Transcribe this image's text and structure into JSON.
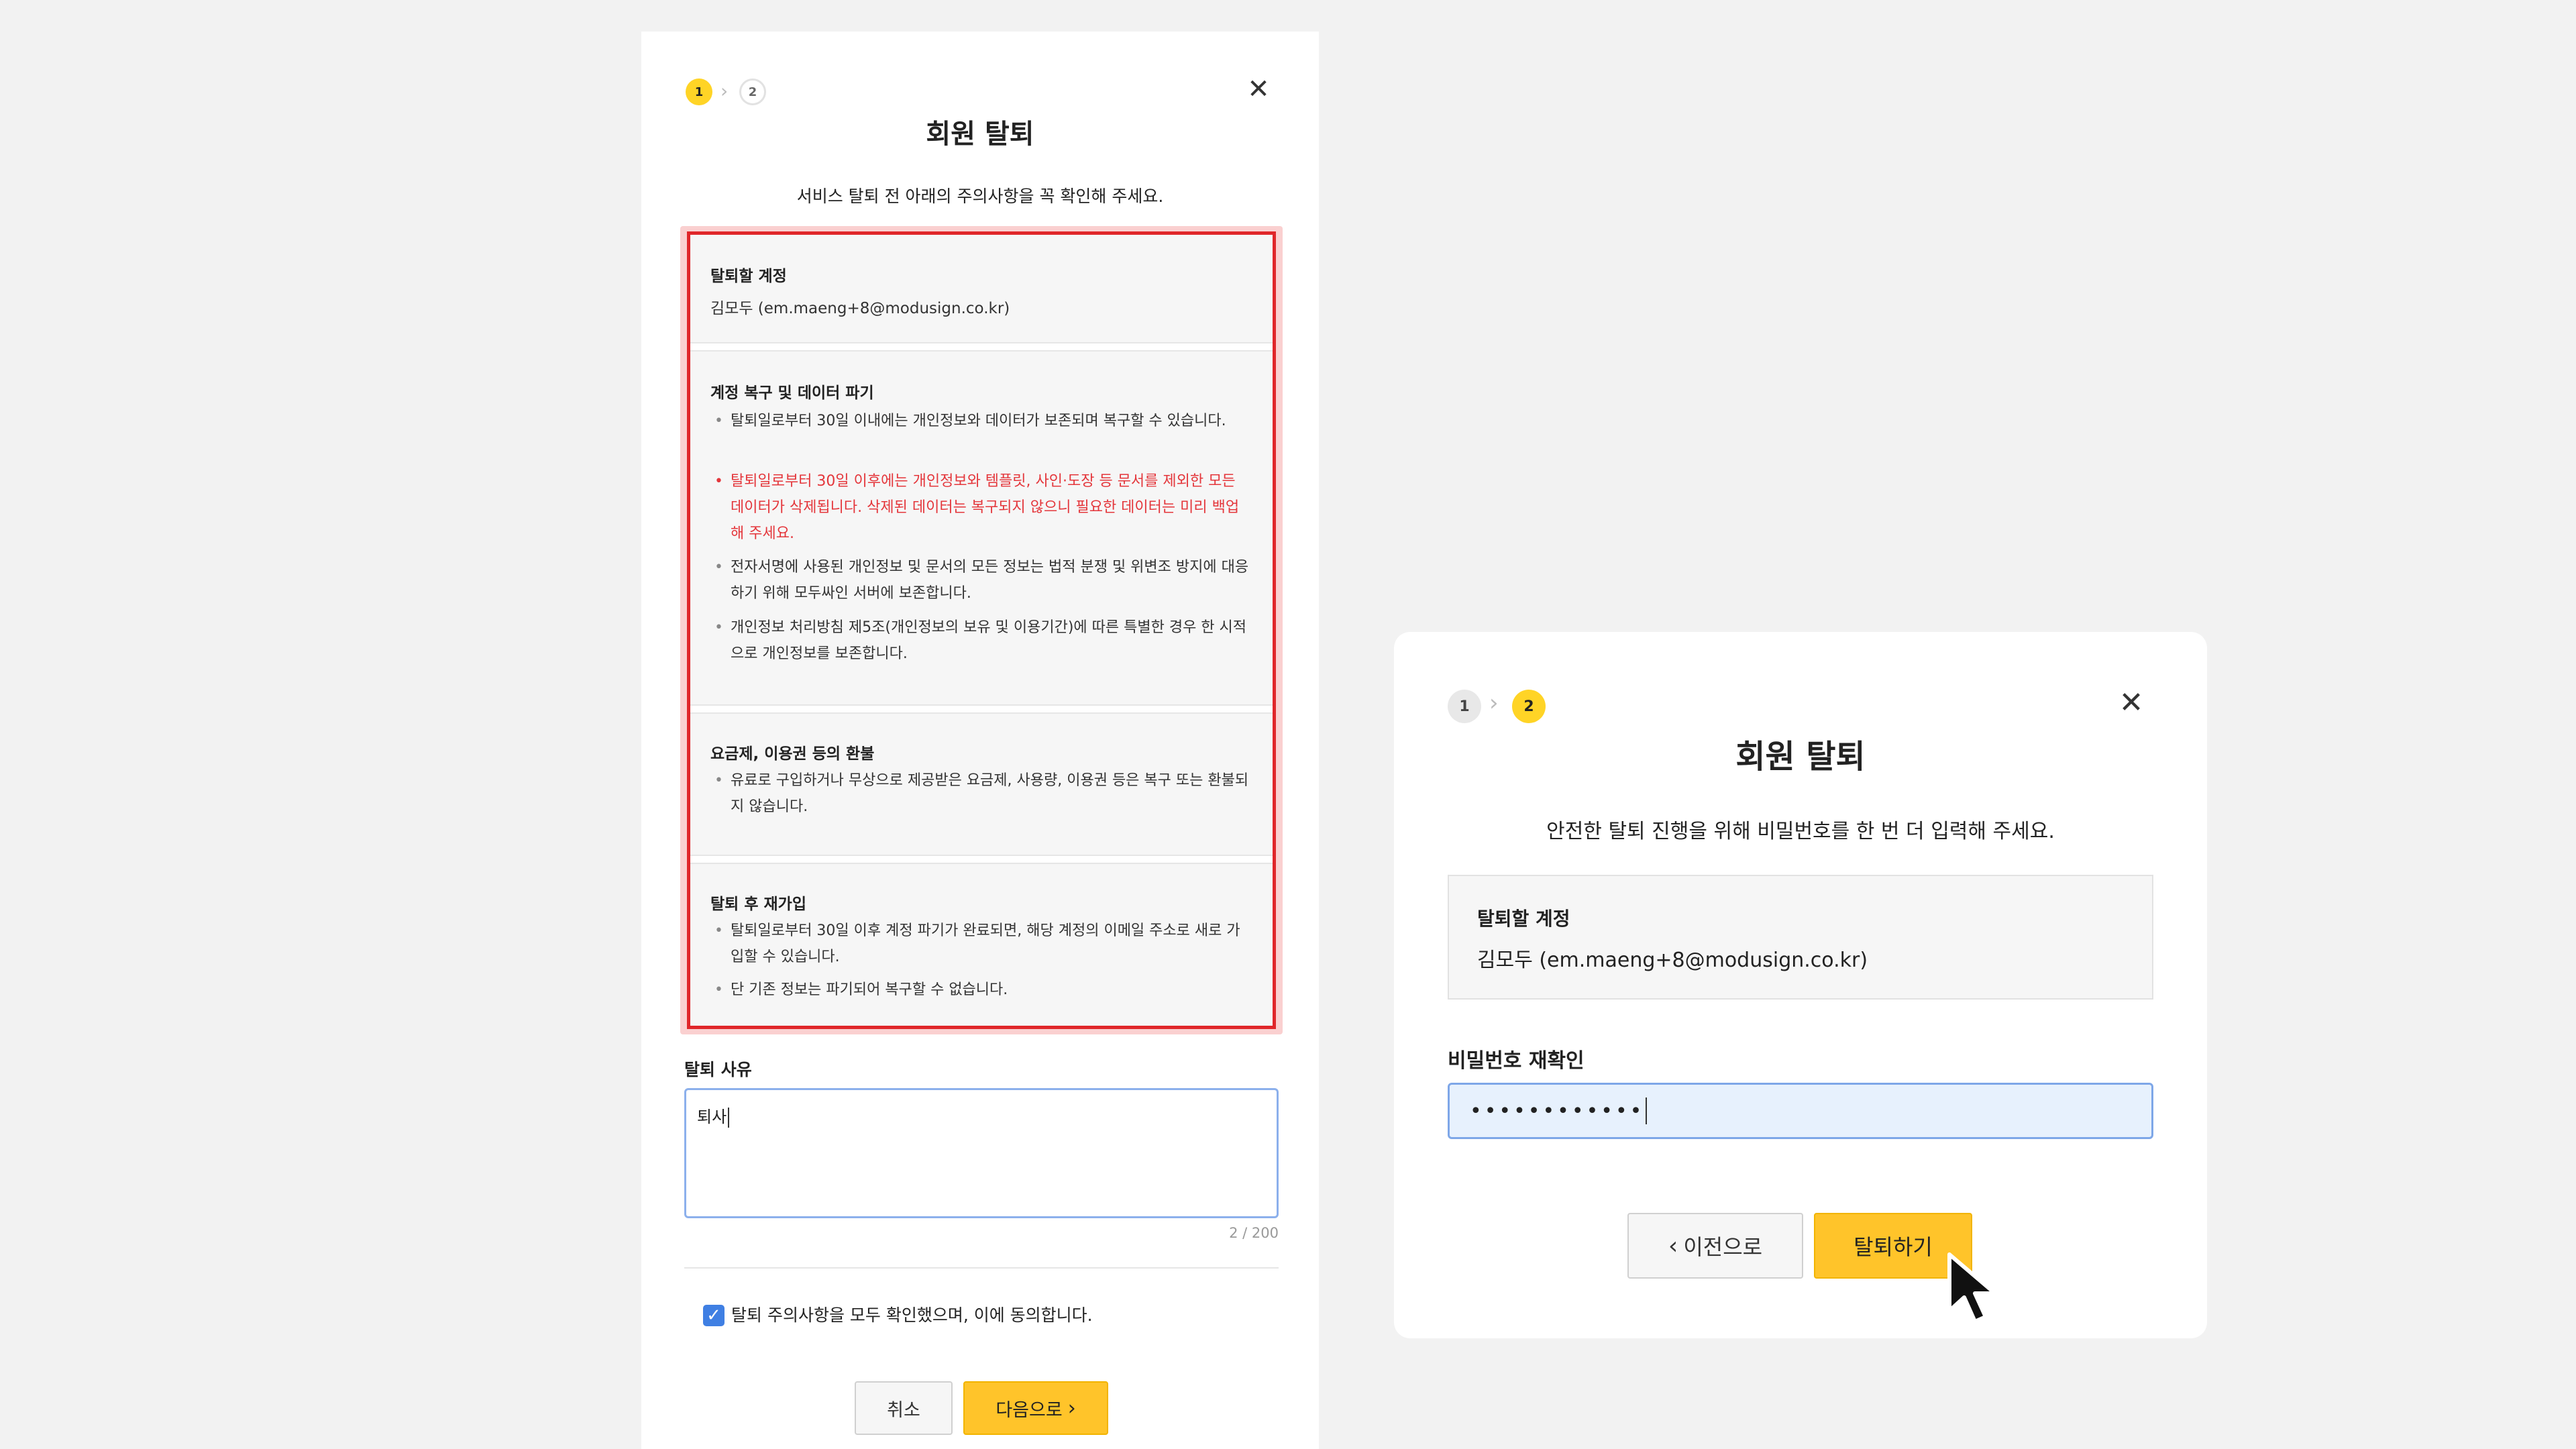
{
  "step1": {
    "steps": [
      "1",
      "2"
    ],
    "title": "회원 탈퇴",
    "subtitle": "서비스 탈퇴 전 아래의 주의사항을 꼭 확인해 주세요.",
    "sections": {
      "account": {
        "title": "탈퇴할 계정",
        "value": "김모두 (em.maeng+8@modusign.co.kr)"
      },
      "recovery": {
        "title": "계정 복구 및 데이터 파기",
        "bullets": [
          "탈퇴일로부터 30일 이내에는 개인정보와 데이터가 보존되며 복구할 수 있습니다.",
          "탈퇴일로부터 30일 이후에는 개인정보와 템플릿, 사인·도장 등 문서를 제외한 모든 데이터가 삭제됩니다. 삭제된 데이터는 복구되지 않으니 필요한 데이터는 미리 백업해 주세요.",
          "전자서명에 사용된 개인정보 및 문서의 모든 정보는 법적 분쟁 및 위변조 방지에 대응하기 위해 모두싸인 서버에 보존합니다.",
          "개인정보 처리방침 제5조(개인정보의 보유 및 이용기간)에 따른 특별한 경우 한 시적으로 개인정보를 보존합니다."
        ]
      },
      "refund": {
        "title": "요금제, 이용권 등의 환불",
        "bullets": [
          "유료로 구입하거나 무상으로 제공받은 요금제, 사용량, 이용권 등은 복구 또는 환불되지 않습니다."
        ]
      },
      "rejoin": {
        "title": "탈퇴 후 재가입",
        "bullets": [
          "탈퇴일로부터 30일 이후 계정 파기가 완료되면, 해당 계정의 이메일 주소로 새로 가입할 수 있습니다.",
          "단 기존 정보는 파기되어 복구할 수 없습니다."
        ]
      }
    },
    "reason": {
      "label": "탈퇴 사유",
      "value": "퇴사",
      "counter": "2 / 200"
    },
    "agree_label": "탈퇴 주의사항을 모두 확인했으며, 이에 동의합니다.",
    "cancel_label": "취소",
    "next_label": "다음으로"
  },
  "step2": {
    "steps": [
      "1",
      "2"
    ],
    "title": "회원 탈퇴",
    "subtitle": "안전한 탈퇴 진행을 위해 비밀번호를 한 번 더 입력해 주세요.",
    "account_title": "탈퇴할 계정",
    "account_value": "김모두 (em.maeng+8@modusign.co.kr)",
    "password_label": "비밀번호 재확인",
    "password_value": "••••••••••••",
    "prev_label": "이전으로",
    "submit_label": "탈퇴하기"
  },
  "colors": {
    "accent": "#ffc42a",
    "step_active": "#ffd426",
    "warning_red": "#e4363b",
    "highlight_outline": "#e0262a",
    "focus_blue": "#7ea7e8",
    "checkbox_blue": "#3f7fe3"
  },
  "icons": {
    "close": "close-icon",
    "step_chevron": "chevron-right-icon",
    "back_chevron": "chevron-left-icon",
    "next_chevron": "chevron-right-icon",
    "check": "checkmark-icon",
    "cursor": "mouse-pointer-icon"
  }
}
